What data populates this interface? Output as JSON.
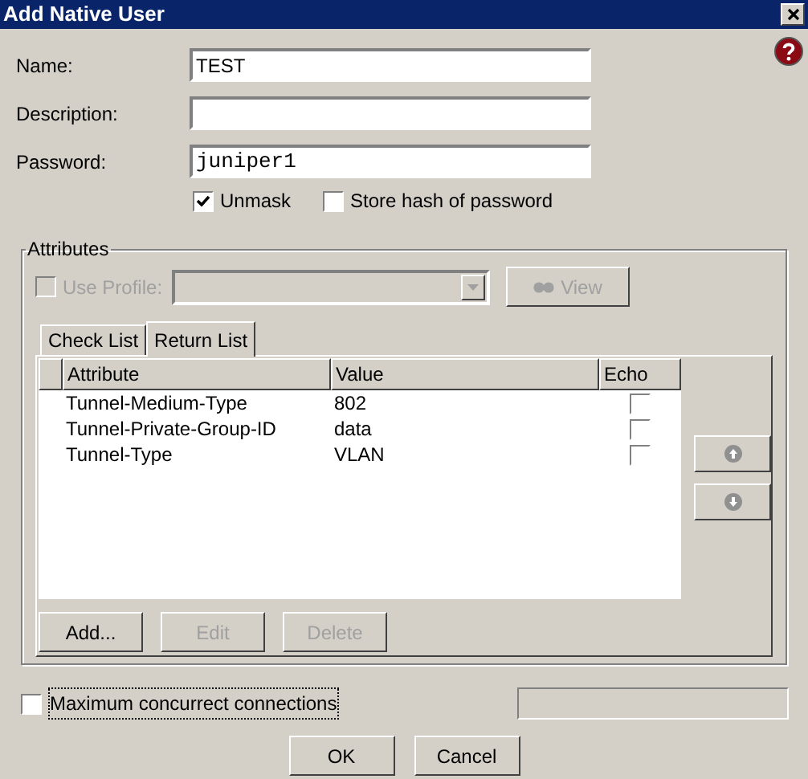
{
  "window": {
    "title": "Add Native User"
  },
  "fields": [
    {
      "label": "Name:",
      "value": "TEST",
      "kind": "text"
    },
    {
      "label": "Description:",
      "kind": "text"
    },
    {
      "label": "Password:",
      "value": "juniper1",
      "kind": "mono"
    }
  ],
  "password_options": [
    {
      "label": "Unmask",
      "checked": true
    },
    {
      "label": "Store hash of password",
      "checked": false
    }
  ],
  "attributes": {
    "title": "Attributes",
    "use_profile": {
      "label": "Use Profile:",
      "checked": false,
      "disabled": true
    },
    "view_button": {
      "label": "View",
      "disabled": true
    },
    "tabs": [
      {
        "label": "Check List",
        "selected": false
      },
      {
        "label": "Return List",
        "selected": true
      }
    ],
    "table": {
      "columns": [
        "Attribute",
        "Value",
        "Echo"
      ],
      "rows": [
        {
          "attribute": "Tunnel-Medium-Type",
          "value": "802",
          "echo": false
        },
        {
          "attribute": "Tunnel-Private-Group-ID",
          "value": "data",
          "echo": false
        },
        {
          "attribute": "Tunnel-Type",
          "value": "VLAN",
          "echo": false
        }
      ]
    },
    "move_buttons": [
      {
        "kind": "up",
        "disabled": true
      },
      {
        "kind": "down",
        "disabled": true
      }
    ],
    "buttons": [
      {
        "label": "Add...",
        "disabled": false
      },
      {
        "label": "Edit",
        "disabled": true
      },
      {
        "label": "Delete",
        "disabled": true
      }
    ]
  },
  "max_connections": {
    "label": "Maximum concurrect connections",
    "checked": false
  },
  "buttons": [
    {
      "label": "OK"
    },
    {
      "label": "Cancel"
    }
  ]
}
